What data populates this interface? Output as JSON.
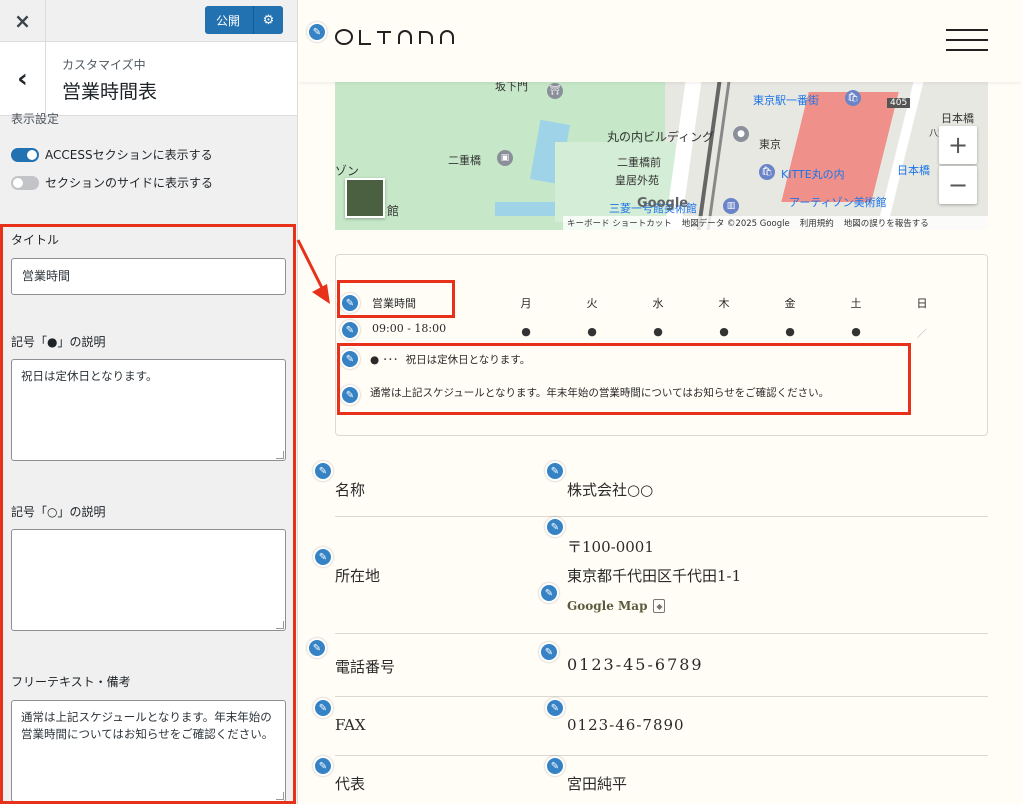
{
  "customizer": {
    "close_icon": "×",
    "publish_label": "公開",
    "gear_icon": "⚙",
    "back_icon": "‹",
    "breadcrumb": "カスタマイズ中",
    "section_title": "営業時間表",
    "display_settings_label": "表示設定",
    "toggles": [
      {
        "label": "ACCESSセクションに表示する",
        "on": true
      },
      {
        "label": "セクションのサイドに表示する",
        "on": false
      }
    ],
    "title_label": "タイトル",
    "title_value": "営業時間",
    "filled_symbol_label": "記号「●」の説明",
    "filled_symbol_value": "祝日は定休日となります。",
    "open_symbol_label": "記号「○」の説明",
    "open_symbol_value": "",
    "free_text_label": "フリーテキスト・備考",
    "free_text_value": "通常は上記スケジュールとなります。年末年始の営業時間についてはお知らせをご確認ください。"
  },
  "site": {
    "logo": "OLTANA",
    "map": {
      "labels": {
        "sakashitamon": "坂下門",
        "nijubashi": "二重橋",
        "marunouchi_bldg": "丸の内ビルディング",
        "nijubashimae": "二重橋前",
        "kokyo_gaien": "皇居外苑",
        "tokyo": "東京",
        "tokyo_ichibangai": "東京駅一番街",
        "kitte": "KITTE丸の内",
        "artizon": "アーティゾン美術館",
        "mitsubishi": "三菱一号館美術館",
        "nihonbashi_1": "日本橋",
        "nihonbashi_2": "日本橋",
        "route405": "405",
        "zon": "ゾン",
        "kan": "館",
        "yaesu": "八重洲"
      },
      "google": "Google",
      "attribution": [
        "キーボード ショートカット",
        "地図データ ©2025 Google",
        "利用規約",
        "地図の誤りを報告する"
      ]
    },
    "hours": {
      "title": "営業時間",
      "time": "09:00 - 18:00",
      "days": [
        "月",
        "火",
        "水",
        "木",
        "金",
        "土",
        "日"
      ],
      "marks": [
        "●",
        "●",
        "●",
        "●",
        "●",
        "●",
        "／"
      ],
      "legend_symbol": "● ･･･",
      "legend_text": "祝日は定休日となります。",
      "free_text": "通常は上記スケジュールとなります。年末年始の営業時間についてはお知らせをご確認ください。"
    },
    "info": {
      "name_key": "名称",
      "name_val": "株式会社○○",
      "address_key": "所在地",
      "postal": "〒100-0001",
      "address": "東京都千代田区千代田1-1",
      "gmap_link": "Google Map",
      "phone_key": "電話番号",
      "phone_val": "0123-45-6789",
      "fax_key": "FAX",
      "fax_val": "0123-46-7890",
      "rep_key": "代表",
      "rep_val": "宮田純平"
    }
  },
  "colors": {
    "wp_blue": "#2271b1",
    "highlight_red": "#e8311a",
    "preview_bg": "#fffdf6"
  }
}
